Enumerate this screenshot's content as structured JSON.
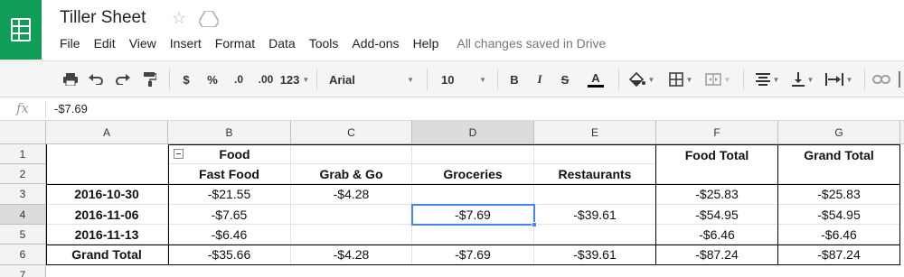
{
  "app": {
    "title": "Tiller Sheet",
    "save_status": "All changes saved in Drive"
  },
  "menu": [
    "File",
    "Edit",
    "View",
    "Insert",
    "Format",
    "Data",
    "Tools",
    "Add-ons",
    "Help"
  ],
  "toolbar": {
    "currency": "$",
    "percent": "%",
    "decrease_decimal": ".0",
    "increase_decimal": ".00",
    "more_formats": "123",
    "font": "Arial",
    "font_size": "10",
    "bold": "B",
    "italic": "I",
    "strikethrough": "S",
    "text_color": "A",
    "text_color_swatch": "#000000"
  },
  "formula_bar": {
    "fx": "fx",
    "value": "-$7.69"
  },
  "columns": [
    "A",
    "B",
    "C",
    "D",
    "E",
    "F",
    "G"
  ],
  "rows": [
    "1",
    "2",
    "3",
    "4",
    "5",
    "6",
    "7"
  ],
  "pivot": {
    "group_label": "Food",
    "food_total_header": "Food Total",
    "grand_total_header": "Grand Total",
    "categories": [
      "Fast Food",
      "Grab & Go",
      "Groceries",
      "Restaurants"
    ],
    "data_rows": [
      {
        "label": "2016-10-30",
        "values": [
          "-$21.55",
          "-$4.28",
          "",
          "",
          "-$25.83",
          "-$25.83"
        ]
      },
      {
        "label": "2016-11-06",
        "values": [
          "-$7.65",
          "",
          "-$7.69",
          "-$39.61",
          "-$54.95",
          "-$54.95"
        ]
      },
      {
        "label": "2016-11-13",
        "values": [
          "-$6.46",
          "",
          "",
          "",
          "-$6.46",
          "-$6.46"
        ]
      }
    ],
    "grand_total_row": {
      "label": "Grand Total",
      "values": [
        "-$35.66",
        "-$4.28",
        "-$7.69",
        "-$39.61",
        "-$87.24",
        "-$87.24"
      ]
    }
  },
  "colors": {
    "brand": "#0f9d58",
    "selection": "#4285f4"
  }
}
